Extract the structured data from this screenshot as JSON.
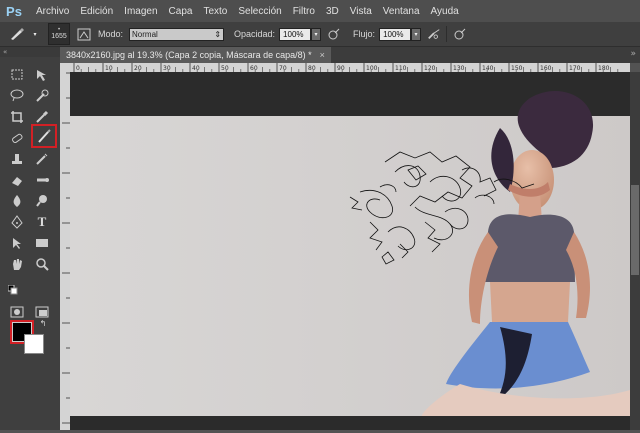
{
  "app": {
    "logo": "Ps"
  },
  "menu": [
    "Archivo",
    "Edición",
    "Imagen",
    "Capa",
    "Texto",
    "Selección",
    "Filtro",
    "3D",
    "Vista",
    "Ventana",
    "Ayuda"
  ],
  "options": {
    "brush_size": "1655",
    "mode_label": "Modo:",
    "mode_value": "Normal",
    "opacity_label": "Opacidad:",
    "opacity_value": "100%",
    "flow_label": "Flujo:",
    "flow_value": "100%"
  },
  "toolbox": {
    "collapse_label": "«",
    "panel_collapse": "»"
  },
  "document": {
    "tab_label": "3840x2160.jpg al 19.3% (Capa 2 copia, Máscara de capa/8) *",
    "close_label": "×"
  },
  "ruler": {
    "h_ticks": [
      "0",
      "10",
      "20",
      "30",
      "40",
      "50",
      "60",
      "70",
      "80",
      "90",
      "100",
      "110",
      "120",
      "130",
      "140",
      "150",
      "160",
      "170",
      "180"
    ]
  },
  "colors": {
    "foreground": "#000000",
    "background": "#ffffff",
    "highlight": "#d32025",
    "photo_bg": "#d4d2d1"
  }
}
